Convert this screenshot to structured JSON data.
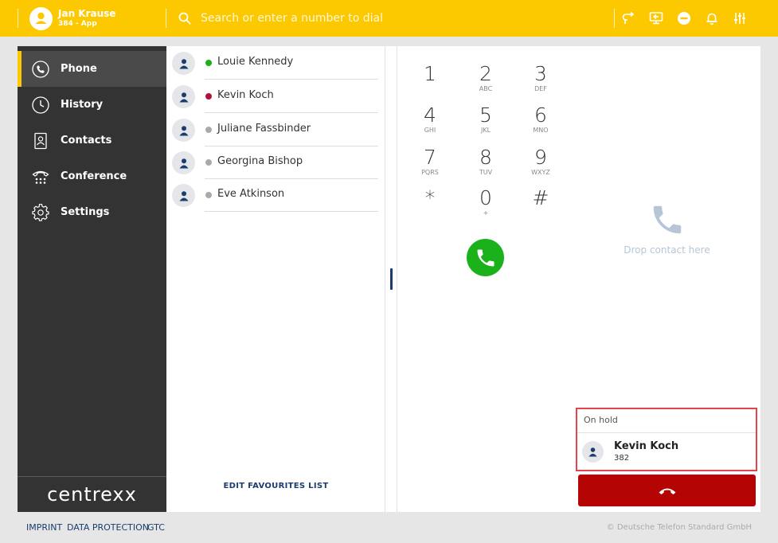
{
  "header": {
    "user_name": "Jan Krause",
    "user_ext": "384 - App",
    "search_placeholder": "Search or enter a number to dial",
    "icons": [
      "call-forward-icon",
      "screen-share-icon",
      "do-not-disturb-icon",
      "bell-icon",
      "sliders-icon"
    ],
    "accent_color": "#fcc800"
  },
  "sidebar": {
    "items": [
      {
        "label": "Phone",
        "icon": "phone-icon",
        "active": true
      },
      {
        "label": "History",
        "icon": "clock-icon",
        "active": false
      },
      {
        "label": "Contacts",
        "icon": "contact-card-icon",
        "active": false
      },
      {
        "label": "Conference",
        "icon": "conference-phone-icon",
        "active": false
      },
      {
        "label": "Settings",
        "icon": "gear-icon",
        "active": false
      }
    ],
    "logo": "centrexx"
  },
  "favourites": {
    "items": [
      {
        "name": "Louie Kennedy",
        "status_color": "#1ab11a"
      },
      {
        "name": "Kevin Koch",
        "status_color": "#b0103a"
      },
      {
        "name": "Juliane Fassbinder",
        "status_color": "#aaaaaa"
      },
      {
        "name": "Georgina Bishop",
        "status_color": "#aaaaaa"
      },
      {
        "name": "Eve Atkinson",
        "status_color": "#aaaaaa"
      }
    ],
    "edit_label": "EDIT FAVOURITES LIST"
  },
  "dialpad": {
    "keys": [
      {
        "digit": "1",
        "letters": ""
      },
      {
        "digit": "2",
        "letters": "ABC"
      },
      {
        "digit": "3",
        "letters": "DEF"
      },
      {
        "digit": "4",
        "letters": "GHI"
      },
      {
        "digit": "5",
        "letters": "JKL"
      },
      {
        "digit": "6",
        "letters": "MNO"
      },
      {
        "digit": "7",
        "letters": "PQRS"
      },
      {
        "digit": "8",
        "letters": "TUV"
      },
      {
        "digit": "9",
        "letters": "WXYZ"
      },
      {
        "digit": "*",
        "letters": ""
      },
      {
        "digit": "0",
        "letters": "+"
      },
      {
        "digit": "#",
        "letters": ""
      }
    ],
    "call_color": "#1ab11a"
  },
  "call_panel": {
    "drop_text": "Drop contact here",
    "hold_title": "On hold",
    "hold_name": "Kevin Koch",
    "hold_ext": "382",
    "hangup_color": "#b40404"
  },
  "footer": {
    "links": [
      "IMPRINT",
      "DATA PROTECTION",
      "GTC"
    ],
    "copyright": "© Deutsche Telefon Standard GmbH"
  }
}
